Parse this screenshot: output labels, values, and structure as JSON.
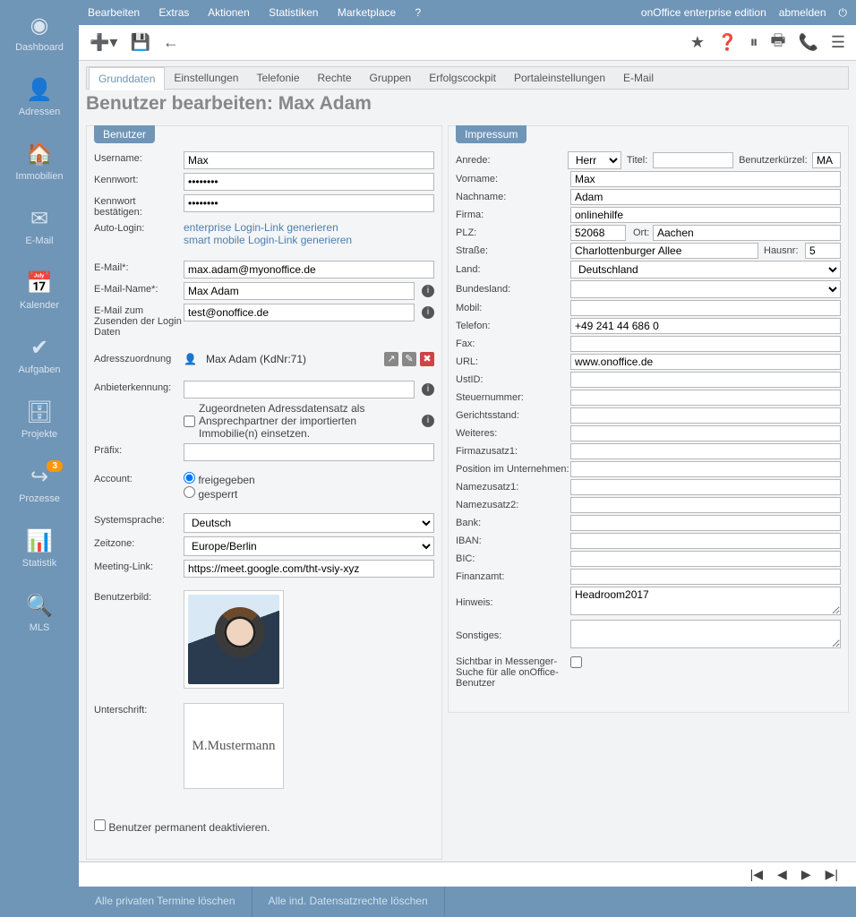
{
  "app": {
    "edition": "onOffice enterprise edition",
    "logout": "abmelden"
  },
  "topmenu": [
    "Bearbeiten",
    "Extras",
    "Aktionen",
    "Statistiken",
    "Marketplace",
    "?"
  ],
  "sidebar": [
    {
      "label": "Dashboard",
      "icon": "◉"
    },
    {
      "label": "Adressen",
      "icon": "👤"
    },
    {
      "label": "Immobilien",
      "icon": "🏠"
    },
    {
      "label": "E-Mail",
      "icon": "✉"
    },
    {
      "label": "Kalender",
      "icon": "📅"
    },
    {
      "label": "Aufgaben",
      "icon": "✔"
    },
    {
      "label": "Projekte",
      "icon": "🗄"
    },
    {
      "label": "Prozesse",
      "icon": "↪",
      "badge": "3"
    },
    {
      "label": "Statistik",
      "icon": "📊"
    },
    {
      "label": "MLS",
      "icon": "🔍"
    }
  ],
  "tabs": [
    "Grunddaten",
    "Einstellungen",
    "Telefonie",
    "Rechte",
    "Gruppen",
    "Erfolgscockpit",
    "Portaleinstellungen",
    "E-Mail"
  ],
  "page_title": "Benutzer bearbeiten: Max Adam",
  "panel_left_title": "Benutzer",
  "panel_right_title": "Impressum",
  "left": {
    "labels": {
      "username": "Username:",
      "password": "Kennwort:",
      "password2": "Kennwort bestätigen:",
      "autologin": "Auto-Login:",
      "email": "E-Mail*:",
      "emailname": "E-Mail-Name*:",
      "emaillogin": "E-Mail zum Zusenden der Login Daten",
      "addr": "Adresszuordnung",
      "anbieter": "Anbieterkennung:",
      "prefix": "Präfix:",
      "account": "Account:",
      "syslang": "Systemsprache:",
      "tz": "Zeitzone:",
      "meeting": "Meeting-Link:",
      "userimg": "Benutzerbild:",
      "sig": "Unterschrift:"
    },
    "values": {
      "username": "Max",
      "password": "••••••••",
      "password2": "••••••••",
      "link_enterprise": "enterprise Login-Link generieren",
      "link_mobile": "smart mobile Login-Link generieren",
      "email": "max.adam@myonoffice.de",
      "emailname": "Max Adam",
      "emaillogin": "test@onoffice.de",
      "addr_text": "Max Adam (KdNr:71)",
      "chk_addr": "Zugeordneten Adressdatensatz als Ansprechpartner der importierten Immobilie(n) einsetzen.",
      "radio_freigegeben": "freigegeben",
      "radio_gesperrt": "gesperrt",
      "syslang": "Deutsch",
      "tz": "Europe/Berlin",
      "meeting": "https://meet.google.com/tht-vsiy-xyz",
      "sig_text": "M.Mustermann",
      "deactivate": "Benutzer permanent deaktivieren."
    }
  },
  "right": {
    "labels": {
      "anrede": "Anrede:",
      "titel": "Titel:",
      "kurzel": "Benutzerkürzel:",
      "vorname": "Vorname:",
      "nachname": "Nachname:",
      "firma": "Firma:",
      "plz": "PLZ:",
      "ort": "Ort:",
      "strasse": "Straße:",
      "hausnr": "Hausnr:",
      "land": "Land:",
      "bundesland": "Bundesland:",
      "mobil": "Mobil:",
      "telefon": "Telefon:",
      "fax": "Fax:",
      "url": "URL:",
      "ustid": "UstID:",
      "steuernr": "Steuernummer:",
      "gericht": "Gerichtsstand:",
      "weiteres": "Weiteres:",
      "firmazusatz1": "Firmazusatz1:",
      "position": "Position im Unternehmen:",
      "namezusatz1": "Namezusatz1:",
      "namezusatz2": "Namezusatz2:",
      "bank": "Bank:",
      "iban": "IBAN:",
      "bic": "BIC:",
      "finanzamt": "Finanzamt:",
      "hinweis": "Hinweis:",
      "sonstiges": "Sonstiges:",
      "messenger": "Sichtbar in Messenger-Suche für alle onOffice-Benutzer"
    },
    "values": {
      "anrede": "Herr",
      "kurzel": "MA",
      "vorname": "Max",
      "nachname": "Adam",
      "firma": "onlinehilfe",
      "plz": "52068",
      "ort": "Aachen",
      "strasse": "Charlottenburger Allee",
      "hausnr": "5",
      "land": "Deutschland",
      "telefon": "+49 241 44 686 0",
      "url": "www.onoffice.de",
      "hinweis": "Headroom2017"
    }
  },
  "footer": {
    "btn1": "Alle privaten Termine löschen",
    "btn2": "Alle ind. Datensatzrechte löschen"
  }
}
